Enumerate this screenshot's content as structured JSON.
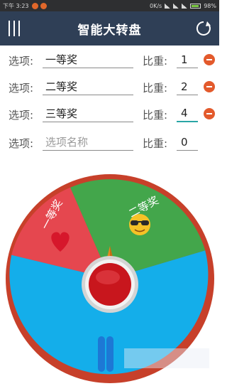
{
  "status_bar": {
    "time": "下午 3:23",
    "speed": "0K/s",
    "battery": "98%"
  },
  "app_bar": {
    "title": "智能大转盘",
    "menu_icon": "menu-icon",
    "refresh_icon": "refresh-icon"
  },
  "options": [
    {
      "label": "选项:",
      "name": "一等奖",
      "weight_label": "比重:",
      "weight": "1",
      "removable": true
    },
    {
      "label": "选项:",
      "name": "二等奖",
      "weight_label": "比重:",
      "weight": "2",
      "removable": true
    },
    {
      "label": "选项:",
      "name": "三等奖",
      "weight_label": "比重:",
      "weight": "4",
      "removable": true
    },
    {
      "label": "选项:",
      "name": "",
      "placeholder": "选项名称",
      "weight_label": "比重:",
      "weight": "0",
      "removable": false
    }
  ],
  "wheel": {
    "segments": [
      {
        "label": "一等奖",
        "weight": 1,
        "color": "#e5474f",
        "icon": "heart-icon"
      },
      {
        "label": "二等奖",
        "weight": 2,
        "color": "#43a64b",
        "icon": "sunglasses-emoji-icon"
      },
      {
        "label": "三等奖",
        "weight": 4,
        "color": "#14aeea",
        "icon": "none"
      }
    ],
    "rim_color": "#c7402a",
    "pointer_color": "#e58a1f",
    "button_color": "#c8161d"
  }
}
